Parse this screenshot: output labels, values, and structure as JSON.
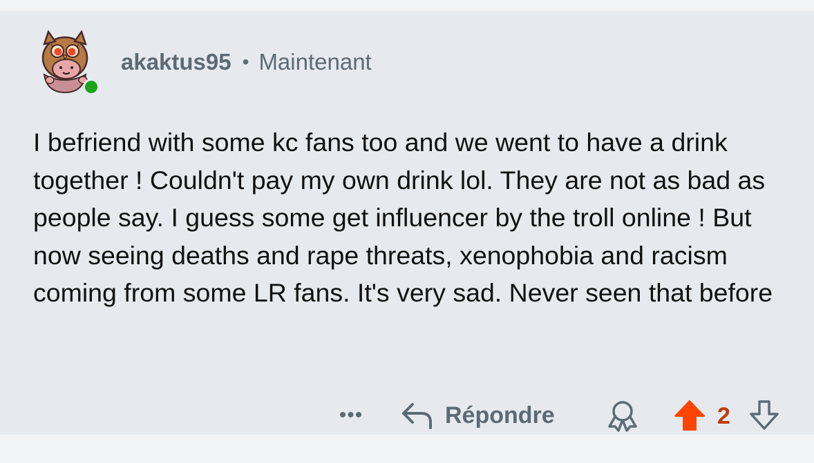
{
  "comment": {
    "author": "akaktus95",
    "separator": "•",
    "timestamp": "Maintenant",
    "online": true,
    "body": "I befriend with some kc fans too and we went to have a drink together ! Couldn't pay my own drink lol. They are not as bad as people say. I guess some get influencer by the troll online ! But now seeing deaths and rape threats, xenophobia and racism coming from some LR fans. It's very sad. Never seen that before"
  },
  "actions": {
    "more_label": "•••",
    "reply_label": "Répondre",
    "score": "2"
  },
  "icons": {
    "avatar": "owl-hooded-character-avatar",
    "online": "online-status-dot",
    "reply": "reply-arrow-icon",
    "award": "award-ribbon-icon",
    "upvote": "upvote-arrow-icon",
    "downvote": "downvote-arrow-icon"
  },
  "colors": {
    "page_background": "#f2f3f5",
    "card_background": "#e6eaee",
    "meta_text": "#5d6a74",
    "body_text": "#111111",
    "upvote_active": "#ff4500",
    "score": "#c1390b",
    "online": "#1aa51a"
  }
}
